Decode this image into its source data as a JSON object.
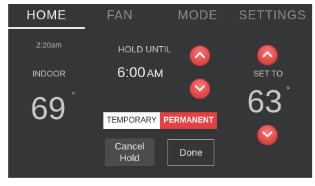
{
  "tabs": [
    {
      "label": "HOME",
      "active": true
    },
    {
      "label": "FAN",
      "active": false
    },
    {
      "label": "MODE",
      "active": false
    },
    {
      "label": "SETTINGS",
      "active": false
    }
  ],
  "home": {
    "time": "2:20am",
    "indoor_label": "INDOOR",
    "indoor_temp": "69",
    "hold_until_label": "HOLD UNTIL",
    "hold_time": "6:00",
    "hold_ampm": "AM",
    "set_to_label": "SET TO",
    "set_temp": "63",
    "degree_symbol": "°"
  },
  "hold_mode": {
    "temporary_label": "TEMPORARY",
    "permanent_label": "PERMANENT",
    "selected": "PERMANENT"
  },
  "actions": {
    "cancel_hold_line1": "Cancel",
    "cancel_hold_line2": "Hold",
    "done_label": "Done"
  },
  "icons": {
    "hold_time_up": "chevron-up-icon",
    "hold_time_down": "chevron-down-icon",
    "setpoint_up": "chevron-up-icon",
    "setpoint_down": "chevron-down-icon"
  },
  "colors": {
    "screen_bg": "#353637",
    "accent_red": "#e24b4b",
    "text_light": "#c9c9c9",
    "inactive_tab": "#8a8c8d"
  }
}
